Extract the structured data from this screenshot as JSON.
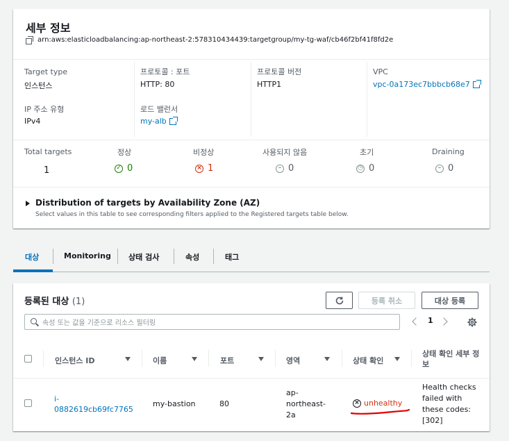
{
  "details": {
    "title": "세부 정보",
    "arn": "arn:aws:elasticloadbalancing:ap-northeast-2:578310434439:targetgroup/my-tg-waf/cb46f2bf41f8fd2e",
    "target_type_label": "Target type",
    "target_type_value": "인스턴스",
    "protocol_port_label": "프로토콜 : 포트",
    "protocol_port_value": "HTTP: 80",
    "protocol_version_label": "프로토콜 버전",
    "protocol_version_value": "HTTP1",
    "vpc_label": "VPC",
    "vpc_value": "vpc-0a173ec7bbbcb68e7",
    "ip_type_label": "IP 주소 유형",
    "ip_type_value": "IPv4",
    "lb_label": "로드 밸런서",
    "lb_value": "my-alb"
  },
  "counts": {
    "total_label": "Total targets",
    "total_value": "1",
    "healthy_label": "정상",
    "healthy_value": "0",
    "unhealthy_label": "비정상",
    "unhealthy_value": "1",
    "unused_label": "사용되지 않음",
    "unused_value": "0",
    "initial_label": "초기",
    "initial_value": "0",
    "draining_label": "Draining",
    "draining_value": "0"
  },
  "az": {
    "title": "Distribution of targets by Availability Zone (AZ)",
    "description": "Select values in this table to see corresponding filters applied to the Registered targets table below."
  },
  "tabs": [
    "대상",
    "Monitoring",
    "상태 검사",
    "속성",
    "태그"
  ],
  "targets": {
    "title": "등록된 대상",
    "count": "(1)",
    "deregister_label": "등록 취소",
    "register_label": "대상 등록",
    "search_placeholder": "속성 또는 값을 기준으로 리소스 필터링",
    "page": "1",
    "columns": [
      "인스턴스 ID",
      "이름",
      "포트",
      "영역",
      "상태 확인",
      "상태 확인 세부 정보"
    ],
    "rows": [
      {
        "instance_id_1": "i-",
        "instance_id_2": "0882619cb69fc7765",
        "name": "my-bastion",
        "port": "80",
        "zone_1": "ap-",
        "zone_2": "northeast-",
        "zone_3": "2a",
        "health": "unhealthy",
        "details_1": "Health checks",
        "details_2": "failed with",
        "details_3": "these codes:",
        "details_4": "[302]"
      }
    ]
  },
  "colors": {
    "link": "#0073bb",
    "healthy": "#1d8102",
    "unhealthy": "#d13212",
    "neutral": "#879596",
    "annotation": "#e00000"
  }
}
